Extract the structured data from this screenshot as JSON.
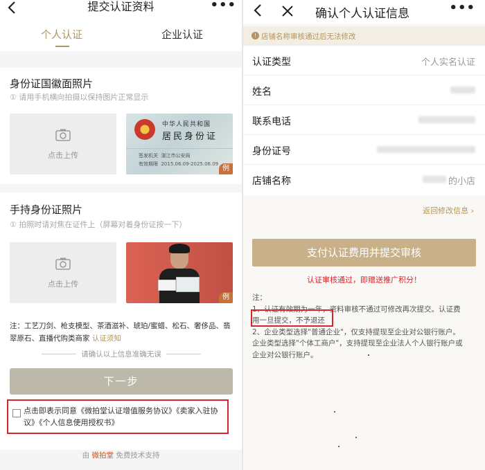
{
  "left": {
    "nav": {
      "title": "提交认证资料",
      "back_icon": "chevron-left-icon",
      "more_icon": "more-dots-icon",
      "more_label": "•••"
    },
    "tabs": [
      {
        "label": "个人认证",
        "active": true
      },
      {
        "label": "企业认证",
        "active": false
      }
    ],
    "id_front": {
      "title": "身份证国徽面照片",
      "hint": "① 请用手机横向拍摄以保持图片正常显示",
      "upload_label": "点击上传",
      "sample": {
        "line1": "中华人民共和国",
        "line2": "居民身份证",
        "authority_label": "签发机关",
        "authority_value": "湛江市公安局",
        "validity_label": "有效期限",
        "validity_value": "2015.06.09-2025.06.09",
        "mark": "例"
      }
    },
    "id_hold": {
      "title": "手持身份证照片",
      "hint": "① 拍照时请对焦在证件上（屏幕对着身份证按一下）",
      "upload_label": "点击上传",
      "sample_mark": "例"
    },
    "notice": {
      "text": "注：工艺刀剑、枪支模型、茶酒滋补、琥珀/蜜蜡、松石、奢侈品、翡翠原石、直播代购类商家",
      "link": "认证须知"
    },
    "confirm_line": "请确认以上信息准确无误",
    "next_button": "下一步",
    "agreement": "点击即表示同意《微拍堂认证增值服务协议》《卖家入驻协议》《个人信息使用授权书》",
    "footer": {
      "prefix": "由",
      "brand": "微拍堂",
      "suffix": "免费技术支持"
    }
  },
  "right": {
    "nav": {
      "title": "确认个人认证信息",
      "back_icon": "chevron-left-icon",
      "close_icon": "close-icon",
      "more_icon": "more-dots-icon",
      "more_label": "•••"
    },
    "banner": {
      "icon": "info-icon",
      "icon_glyph": "!",
      "text": "店铺名称审核通过后无法修改"
    },
    "info": [
      {
        "label": "认证类型",
        "value": "个人实名认证"
      },
      {
        "label": "姓名",
        "value": ""
      },
      {
        "label": "联系电话",
        "value": ""
      },
      {
        "label": "身份证号",
        "value": ""
      },
      {
        "label": "店铺名称",
        "value": "的小店"
      }
    ],
    "back_edit": "返回修改信息 ›",
    "pay_button": "支付认证费用并提交审核",
    "reward": "认证审核通过，即赠送推广积分！",
    "notes": {
      "title": "注：",
      "line1": "1、认证有效期为一年，资料审核不通过可修改再次提交。认证费",
      "line2_highlight": "用一旦提交，不予退还",
      "line3": "2、企业类型选择\"普通企业\"，仅支持提现至企业对公银行账户。",
      "line4": "企业类型选择\"个体工商户\"，支持提现至企业法人个人银行账户或",
      "line5": "企业对公银行账户。"
    }
  },
  "colors": {
    "accent": "#b39460",
    "highlight_border": "#d8232a",
    "next_button": "#bdb9aa",
    "pay_button": "#c8b188"
  }
}
